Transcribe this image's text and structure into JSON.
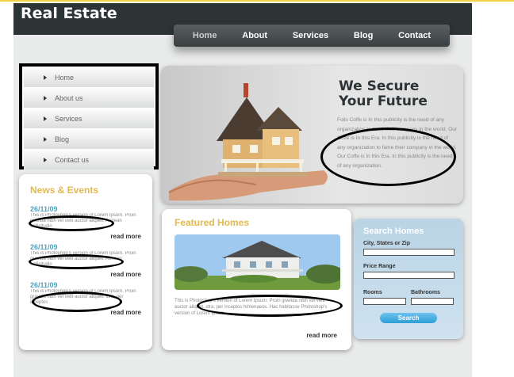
{
  "header": {
    "logo": "Real Estate"
  },
  "nav": {
    "items": [
      "Home",
      "About",
      "Services",
      "Blog",
      "Contact"
    ]
  },
  "side_menu": {
    "items": [
      "Home",
      "About us",
      "Services",
      "Blog",
      "Contact us"
    ]
  },
  "news": {
    "title": "News & Events",
    "items": [
      {
        "date": "26/11/09",
        "text": "This is Photoshop's version of Lorem Ipsum. Proin gravida nibh vel velit auctor aliquet. Aenean sollicitudin",
        "more": "read more"
      },
      {
        "date": "26/11/09",
        "text": "This is Photoshop's version of Lorem Ipsum. Proin gravida nibh vel velit auctor aliquet. Aenean sollicitudin",
        "more": "read more"
      },
      {
        "date": "26/11/09",
        "text": "This is Photoshop's version of Lorem Ipsum. Proin gravida nibh vel velit auctor aliquet. stra, per inceptos",
        "more": "read more"
      }
    ]
  },
  "hero": {
    "title_line1": "We Secure",
    "title_line2": "Your Future",
    "text": "Foils Coffe is In this publicity is the need of any organization to fame their company in the world. Our Coffe is In this Era. In this publicity is the need of any organization to fame their company in the world. Our Coffe is In this Era. In this publicity is the need of any organization."
  },
  "featured": {
    "title": "Featured Homes",
    "text": "This is Photoshop's version of Lorem Ipsum. Proin gravida nibh vel velit auctor aliquet. stra, per inceptos himenaeos. Hac habitasse Photoshop's version of Lorem Ipsum.",
    "more": "read more"
  },
  "search": {
    "title": "Search Homes",
    "city_label": "City, States  or Zip",
    "price_label": "Price Range",
    "rooms_label": "Rooms",
    "bathrooms_label": "Bathrooms",
    "button": "Search"
  }
}
